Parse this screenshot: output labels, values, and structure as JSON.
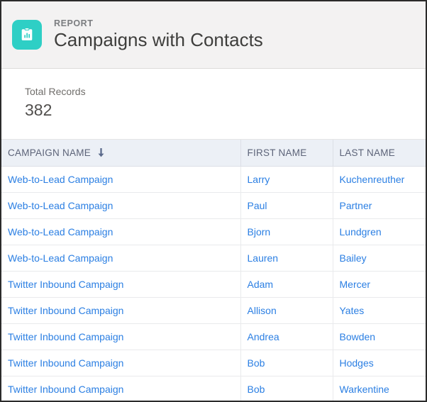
{
  "header": {
    "icon": "report-clipboard-chart-icon",
    "icon_color": "#2ecfc5",
    "eyebrow": "REPORT",
    "title": "Campaigns with Contacts"
  },
  "summary": {
    "label": "Total Records",
    "value": "382"
  },
  "table": {
    "sort_icon": "sort-descending-arrow-icon",
    "sort_column": "CAMPAIGN NAME",
    "sort_direction": "descending",
    "link_color": "#2b7fe3",
    "header_background": "#ecf0f6",
    "columns": [
      {
        "label": "CAMPAIGN NAME",
        "sorted": true
      },
      {
        "label": "FIRST NAME",
        "sorted": false
      },
      {
        "label": "LAST NAME",
        "sorted": false
      }
    ],
    "rows": [
      {
        "campaign": "Web-to-Lead Campaign",
        "first": "Larry",
        "last": "Kuchenreuther"
      },
      {
        "campaign": "Web-to-Lead Campaign",
        "first": "Paul",
        "last": "Partner"
      },
      {
        "campaign": "Web-to-Lead Campaign",
        "first": "Bjorn",
        "last": "Lundgren"
      },
      {
        "campaign": "Web-to-Lead Campaign",
        "first": "Lauren",
        "last": "Bailey"
      },
      {
        "campaign": "Twitter Inbound Campaign",
        "first": "Adam",
        "last": "Mercer"
      },
      {
        "campaign": "Twitter Inbound Campaign",
        "first": "Allison",
        "last": "Yates"
      },
      {
        "campaign": "Twitter Inbound Campaign",
        "first": "Andrea",
        "last": "Bowden"
      },
      {
        "campaign": "Twitter Inbound Campaign",
        "first": "Bob",
        "last": "Hodges"
      },
      {
        "campaign": "Twitter Inbound Campaign",
        "first": "Bob",
        "last": "Warkentine"
      }
    ]
  }
}
